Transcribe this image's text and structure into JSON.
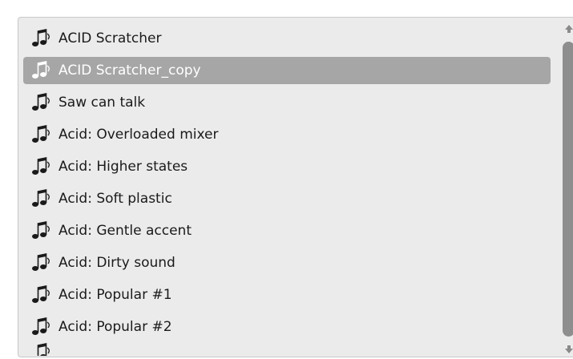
{
  "preset_list": {
    "items": [
      {
        "label": "ACID Scratcher",
        "selected": false
      },
      {
        "label": "ACID Scratcher_copy",
        "selected": true
      },
      {
        "label": "Saw can talk",
        "selected": false
      },
      {
        "label": "Acid: Overloaded mixer",
        "selected": false
      },
      {
        "label": "Acid: Higher states",
        "selected": false
      },
      {
        "label": "Acid: Soft plastic",
        "selected": false
      },
      {
        "label": "Acid: Gentle accent",
        "selected": false
      },
      {
        "label": "Acid: Dirty sound",
        "selected": false
      },
      {
        "label": "Acid: Popular #1",
        "selected": false
      },
      {
        "label": "Acid: Popular #2",
        "selected": false
      }
    ]
  },
  "icons": {
    "item_icon": "music-note-icon",
    "scroll_up": "arrow-up-icon",
    "scroll_down": "arrow-down-icon"
  },
  "colors": {
    "panel_bg": "#ebebeb",
    "selected_bg": "#a6a6a6",
    "selected_text": "#ffffff",
    "text": "#1a1a1a",
    "scroll_thumb": "#8e8e8e"
  }
}
